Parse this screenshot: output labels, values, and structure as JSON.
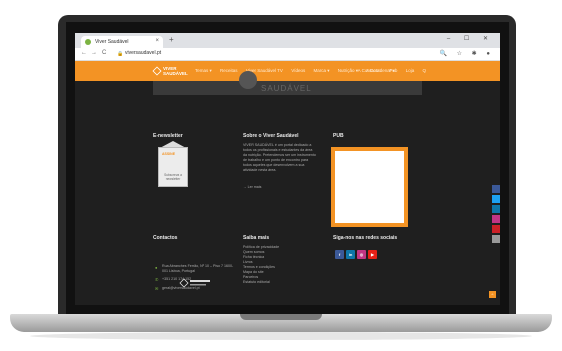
{
  "browser": {
    "tab_title": "Viver Saudável",
    "tab_close": "×",
    "new_tab": "+",
    "window_controls": "–  ☐  ✕",
    "nav_back": "←",
    "nav_forward": "→",
    "nav_reload": "C",
    "url": "viversaudavel.pt",
    "addr_icons": "🔍 ☆ ✱ ●"
  },
  "site": {
    "logo_line1": "VIVER",
    "logo_line2": "SAUDÁVEL",
    "menu": [
      "Temas ▾",
      "Receitas",
      "Viver Saudável TV",
      "Vídeos",
      "Marca ▾",
      "Nutrição ▾",
      "A Coordenar ▾"
    ],
    "menu_right": [
      "A Contactar",
      "Pub",
      "Loja",
      "Q"
    ],
    "hero_text": "SAUDÁVEL"
  },
  "footer": {
    "newsletter": {
      "title": "E-newsletter",
      "envelope_label": "ASSINE",
      "envelope_cta": "Subscreva a newsletter"
    },
    "about": {
      "title": "Sobre o Viver Saudável",
      "text": "VIVER SAUDÁVEL é um portal dedicado a todos os profissionais e estudantes da área da nutrição. Pretendemos ser um instrumento de trabalho e um ponto de encontro para todos aqueles que desenvolvem a sua atividade nesta área.",
      "more": "→ Ler mais"
    },
    "pub": {
      "title": "PUB"
    },
    "contacts": {
      "title": "Contactos",
      "address": "Rua Abranches Ferrão, Nº 10 – Piso 7 1600-001 Lisboa, Portugal",
      "phone": "+351 210 174 152",
      "email": "geral@viversaudavel.pt"
    },
    "links": {
      "title": "Saiba mais",
      "items": [
        "Política de privacidade",
        "Quem somos",
        "Ficha técnica",
        "Livros",
        "Termos e condições",
        "Mapa do site",
        "Parceiros",
        "Estatuto editorial"
      ]
    },
    "social": {
      "title": "Siga-nos nas redes sociais",
      "icons": [
        "f",
        "in",
        "◎",
        "▶"
      ]
    }
  },
  "colors": {
    "brand_orange": "#f39324",
    "footer_bg": "#1f1f1f",
    "facebook": "#3b5998",
    "twitter": "#1da1f2",
    "linkedin": "#0e76a8",
    "instagram": "#c13584",
    "youtube": "#e62117",
    "pinterest": "#cb2027"
  },
  "side_share": [
    "facebook-share-icon",
    "twitter-share-icon",
    "linkedin-share-icon",
    "instagram-share-icon",
    "pinterest-share-icon",
    "print-share-icon"
  ],
  "scroll_top": "^"
}
